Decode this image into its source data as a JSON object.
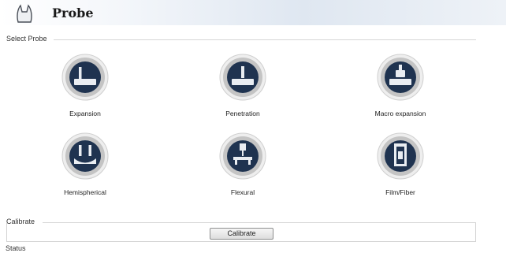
{
  "window": {
    "title": "Probe",
    "icon": "probe-tip-icon"
  },
  "select_probe": {
    "group_title": "Select Probe",
    "probes": [
      {
        "label": "Expansion",
        "icon": "expansion-probe-icon"
      },
      {
        "label": "Penetration",
        "icon": "penetration-probe-icon"
      },
      {
        "label": "Macro expansion",
        "icon": "macro-expansion-probe-icon"
      },
      {
        "label": "Hemispherical",
        "icon": "hemispherical-probe-icon"
      },
      {
        "label": "Flexural",
        "icon": "flexural-probe-icon"
      },
      {
        "label": "Film/Fiber",
        "icon": "film-fiber-probe-icon"
      }
    ]
  },
  "calibrate": {
    "group_title": "Calibrate",
    "button_label": "Calibrate"
  },
  "status": {
    "label": "Status"
  },
  "colors": {
    "probe_dark": "#1f3350",
    "probe_ring": "#c9c9c9",
    "header_gradient_end": "#dfe7f1"
  }
}
